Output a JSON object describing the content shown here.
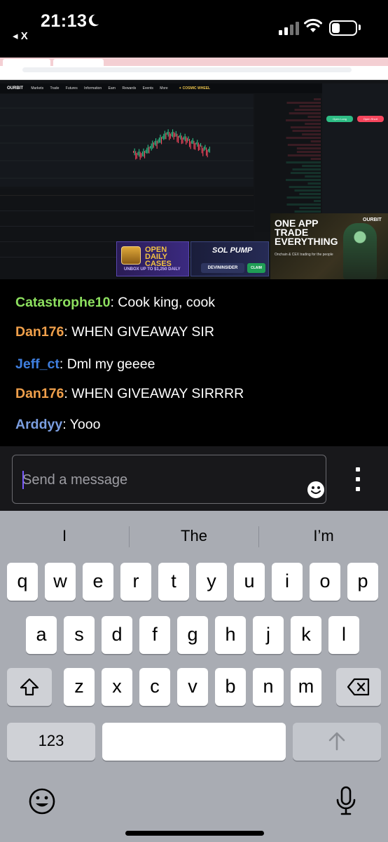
{
  "status_bar": {
    "time": "21:13",
    "back_app": "◂ X"
  },
  "stream": {
    "exchange_nav": {
      "logo": "OURBIT",
      "items": [
        "Markets",
        "Trade",
        "Futures",
        "Information",
        "Earn",
        "Rewards",
        "Events",
        "More"
      ],
      "promo": "✦ COSMIC WHEEL"
    },
    "trade_panel": {
      "long_label": "Open Long",
      "short_label": "Open Short"
    },
    "ads": {
      "one_app_title": "ONE APP TRADE EVERYTHING",
      "one_app_sub": "Onchain & CEX trading for the people",
      "one_app_logo": "OURBIT",
      "cases_title": "OPEN DAILY CASES",
      "cases_sub": "UNBOX UP TO $1,250 DAILY",
      "solpump_title": "SOL PUMP",
      "solpump_code": "DEVININSIDER",
      "solpump_claim": "CLAIM"
    }
  },
  "chat": {
    "messages": [
      {
        "user": "Catastrophe10",
        "text": ": Cook king, cook",
        "color": "#8de05f"
      },
      {
        "user": "Dan176",
        "text": ": WHEN GIVEAWAY SIR",
        "color": "#f0a04b"
      },
      {
        "user": "Jeff_ct",
        "text": ": Dml my geeee",
        "color": "#3f7fe0"
      },
      {
        "user": "Dan176",
        "text": ": WHEN GIVEAWAY SIRRRR",
        "color": "#f0a04b"
      },
      {
        "user": "Arddyy",
        "text": ": Yooo",
        "color": "#7b9ee0"
      }
    ]
  },
  "input": {
    "placeholder": "Send a message"
  },
  "keyboard": {
    "suggestions": [
      "I",
      "The",
      "I’m"
    ],
    "row1": [
      "q",
      "w",
      "e",
      "r",
      "t",
      "y",
      "u",
      "i",
      "o",
      "p"
    ],
    "row2": [
      "a",
      "s",
      "d",
      "f",
      "g",
      "h",
      "j",
      "k",
      "l"
    ],
    "row3": [
      "z",
      "x",
      "c",
      "v",
      "b",
      "n",
      "m"
    ],
    "numbers_label": "123"
  }
}
